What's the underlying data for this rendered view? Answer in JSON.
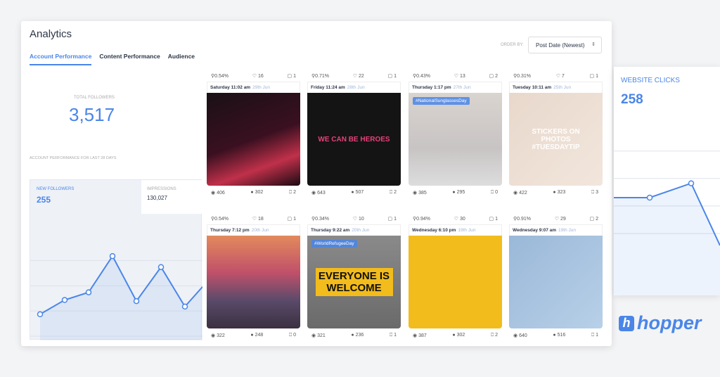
{
  "app": {
    "title": "Analytics",
    "tabs": [
      "Account Performance",
      "Content Performance",
      "Audience"
    ],
    "order_label": "ORDER BY:",
    "order_value": "Post Date (Newest)"
  },
  "summary": {
    "total_followers_label": "TOTAL FOLLOWERS",
    "total_followers": "3,517",
    "period_label": "ACCOUNT PERFORMANCE FOR LAST 28 DAYS",
    "new_followers_label": "NEW FOLLOWERS",
    "new_followers": "255",
    "impressions_label": "IMPRESSIONS",
    "impressions": "130,027"
  },
  "posts": [
    {
      "eng": "0.54%",
      "likes": "16",
      "comments": "1",
      "day": "Saturday 11:02 am",
      "date": "29th Jun",
      "views": "406",
      "reach": "302",
      "saves": "2",
      "bg": "linear-gradient(160deg,#1a1016,#3a1020 50%,#c0304a 75%,#1a0a12)",
      "overlay": "",
      "tag": ""
    },
    {
      "eng": "0.71%",
      "likes": "22",
      "comments": "1",
      "day": "Friday 11:24 am",
      "date": "28th Jun",
      "views": "643",
      "reach": "507",
      "saves": "2",
      "bg": "#141414",
      "overlay": "WE CAN BE HEROES",
      "tag": ""
    },
    {
      "eng": "0.43%",
      "likes": "13",
      "comments": "2",
      "day": "Thursday 1:17 pm",
      "date": "27th Jun",
      "views": "385",
      "reach": "295",
      "saves": "0",
      "bg": "linear-gradient(180deg,#d9d4cf,#c8c4c4 60%,#ddd)",
      "overlay": "",
      "tag": "#NationalSunglassesDay"
    },
    {
      "eng": "0.31%",
      "likes": "7",
      "comments": "1",
      "day": "Tuesday 10:11 am",
      "date": "25th Jun",
      "views": "422",
      "reach": "323",
      "saves": "3",
      "bg": "linear-gradient(135deg,#e8d8cc,#f2e6dc)",
      "overlay": "STICKERS ON PHOTOS #TUESDAYTIP",
      "tag": ""
    },
    {
      "eng": "0.54%",
      "likes": "18",
      "comments": "1",
      "day": "Thursday 7:12 pm",
      "date": "20th Jun",
      "views": "322",
      "reach": "248",
      "saves": "0",
      "bg": "linear-gradient(180deg,#e28a5c,#c0506a 40%,#5a4a6a 70%,#3a3040)",
      "overlay": "",
      "tag": ""
    },
    {
      "eng": "0.34%",
      "likes": "10",
      "comments": "1",
      "day": "Thursday 9:22 am",
      "date": "20th Jun",
      "views": "321",
      "reach": "236",
      "saves": "1",
      "bg": "linear-gradient(180deg,#8a8a8a,#6a6a6a)",
      "overlay": "EVERYONE IS WELCOME",
      "tag": "#WorldRefugeeDay"
    },
    {
      "eng": "0.94%",
      "likes": "30",
      "comments": "1",
      "day": "Wednesday 6:10 pm",
      "date": "19th Jun",
      "views": "387",
      "reach": "302",
      "saves": "2",
      "bg": "#f2bc1c",
      "overlay": "",
      "tag": ""
    },
    {
      "eng": "0.91%",
      "likes": "29",
      "comments": "2",
      "day": "Wednesday 9:07 am",
      "date": "19th Jun",
      "views": "640",
      "reach": "516",
      "saves": "1",
      "bg": "linear-gradient(135deg,#9ab8d8,#b8d0e8)",
      "overlay": "",
      "tag": ""
    }
  ],
  "side": {
    "label": "WEBSITE CLICKS",
    "value": "258"
  },
  "brand": {
    "name": "hopper",
    "mark": "h"
  },
  "colors": {
    "accent": "#4a86e8"
  },
  "chart_data": {
    "type": "area",
    "values": [
      2,
      3.3,
      4,
      7.3,
      3.2,
      6.3,
      2.7,
      4.5
    ],
    "side_values": [
      3,
      3,
      4.2,
      -1
    ]
  }
}
